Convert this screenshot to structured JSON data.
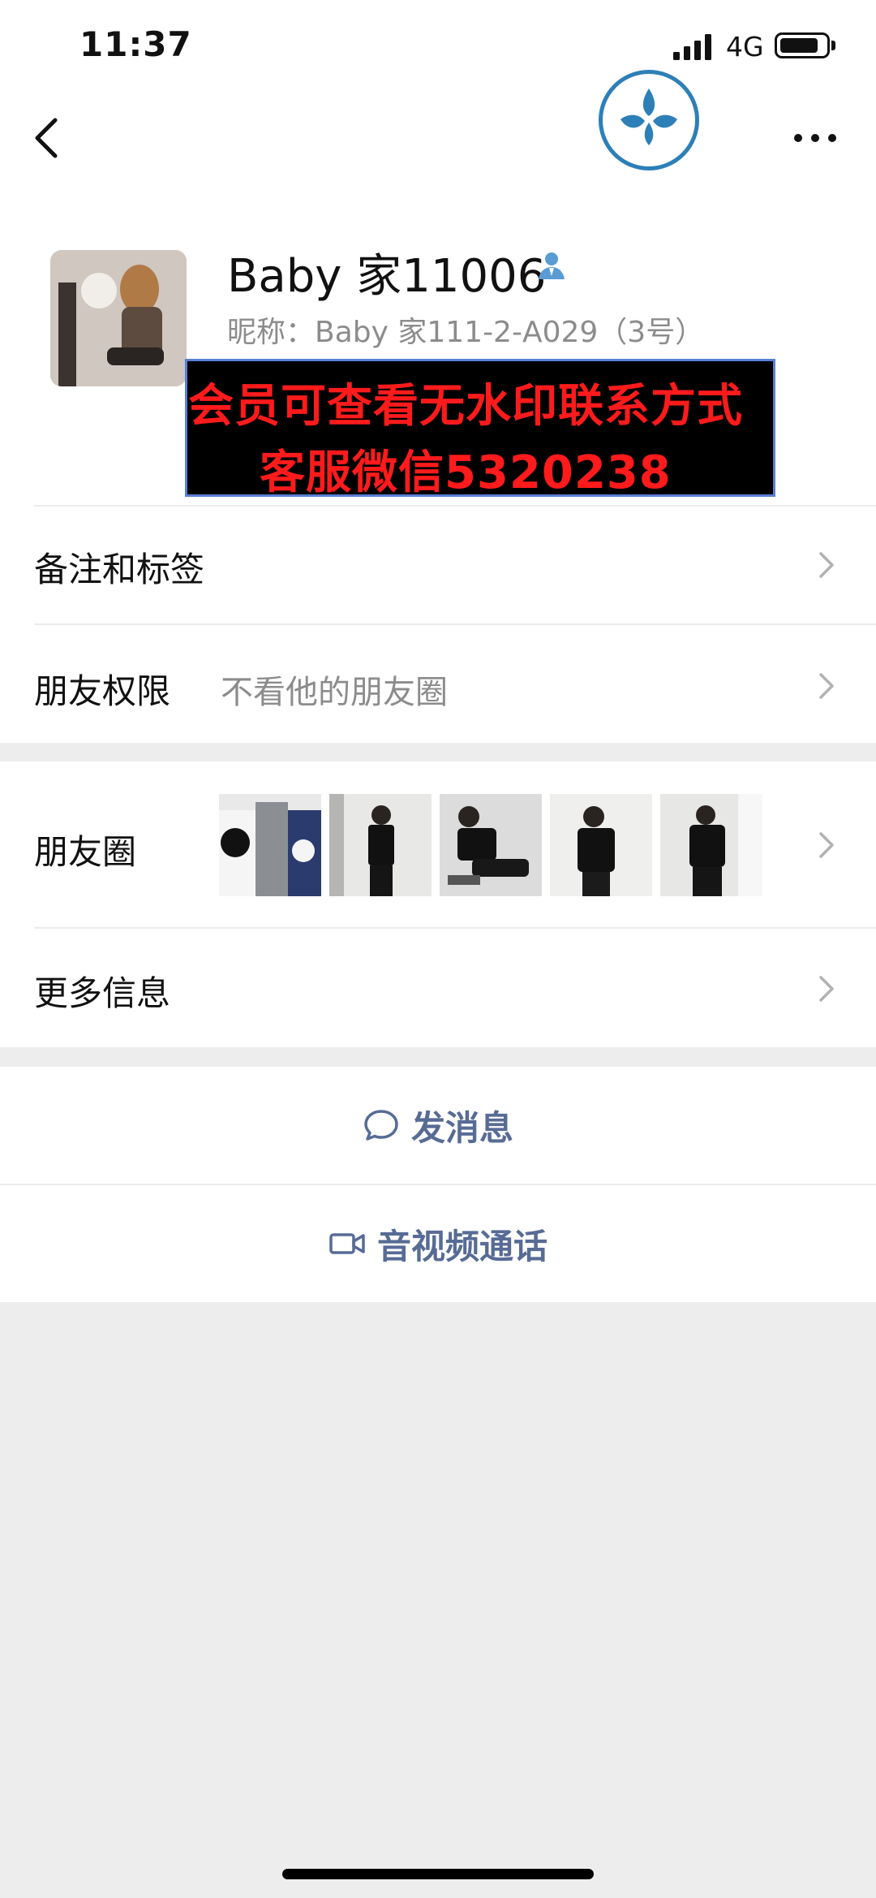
{
  "status_bar": {
    "time": "11:37",
    "network": "4G",
    "battery_level": 0.85
  },
  "profile": {
    "name": "Baby 家11006",
    "nickname": "昵称：Baby 家111-2-A029（3号）"
  },
  "watermark": {
    "line1": "会员可查看无水印联系方式",
    "line2": "客服微信5320238"
  },
  "rows": {
    "notes_tags": {
      "label": "备注和标签"
    },
    "friend_permission": {
      "label": "朋友权限",
      "value": "不看他的朋友圈"
    },
    "moments": {
      "label": "朋友圈"
    },
    "more_info": {
      "label": "更多信息"
    }
  },
  "actions": {
    "send_message": "发消息",
    "video_call": "音视频通话"
  },
  "colors": {
    "link": "#576b95",
    "watermark_text": "#ff1b1b",
    "background": "#ededed"
  },
  "icons": [
    "back-arrow-icon",
    "more-dots-icon",
    "verify-user-icon",
    "chevron-right-icon",
    "chat-bubble-icon",
    "video-camera-icon"
  ]
}
